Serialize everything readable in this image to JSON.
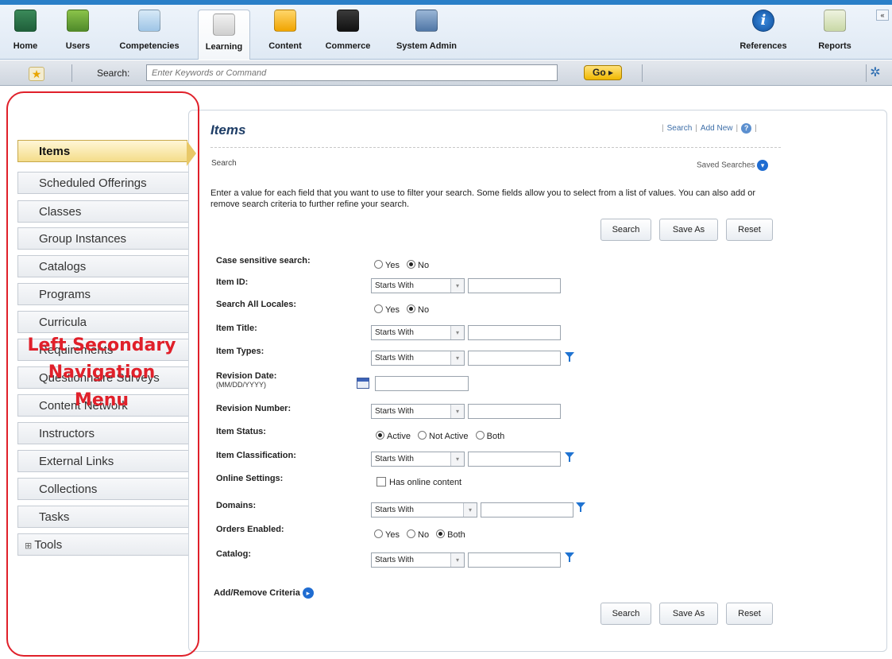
{
  "topnav": {
    "items": [
      {
        "label": "Home",
        "icon": "home-icon"
      },
      {
        "label": "Users",
        "icon": "users-icon"
      },
      {
        "label": "Competencies",
        "icon": "competencies-icon"
      },
      {
        "label": "Learning",
        "icon": "learning-icon",
        "active": true
      },
      {
        "label": "Content",
        "icon": "content-icon"
      },
      {
        "label": "Commerce",
        "icon": "commerce-icon"
      },
      {
        "label": "System Admin",
        "icon": "system-admin-icon"
      },
      {
        "label": "References",
        "icon": "info-icon"
      },
      {
        "label": "Reports",
        "icon": "reports-icon"
      }
    ],
    "collapse_glyph": "«"
  },
  "searchbar": {
    "label": "Search:",
    "placeholder": "Enter Keywords or Command",
    "go_label": "Go ▸"
  },
  "leftnav": {
    "items": [
      {
        "label": "Items",
        "active": true
      },
      {
        "label": "Scheduled Offerings"
      },
      {
        "label": "Classes"
      },
      {
        "label": "Group Instances"
      },
      {
        "label": "Catalogs"
      },
      {
        "label": "Programs"
      },
      {
        "label": "Curricula"
      },
      {
        "label": "Requirements"
      },
      {
        "label": "Questionnaire Surveys"
      },
      {
        "label": "Content Network"
      },
      {
        "label": "Instructors"
      },
      {
        "label": "External Links"
      },
      {
        "label": "Collections"
      },
      {
        "label": "Tasks"
      },
      {
        "label": "Tools",
        "expandable": true
      }
    ]
  },
  "annotation": {
    "lines": [
      "Left Secondary",
      "Navigation",
      "Menu"
    ],
    "color": "#e0202a"
  },
  "main": {
    "title": "Items",
    "header_links": {
      "search": "Search",
      "add_new": "Add New"
    },
    "section": "Search",
    "saved_searches": "Saved Searches",
    "instructions": "Enter a value for each field that you want to use to filter your search. Some fields allow you to select from a list of values. You can also add or remove search criteria to further refine your search.",
    "buttons": {
      "search": "Search",
      "save_as": "Save As",
      "reset": "Reset"
    },
    "fields": {
      "case_sensitive": {
        "label": "Case sensitive search:",
        "yes": "Yes",
        "no": "No",
        "selected": "No"
      },
      "item_id": {
        "label": "Item ID:",
        "operator": "Starts With",
        "value": ""
      },
      "all_locales": {
        "label": "Search All Locales:",
        "yes": "Yes",
        "no": "No",
        "selected": "No"
      },
      "item_title": {
        "label": "Item Title:",
        "operator": "Starts With",
        "value": ""
      },
      "item_types": {
        "label": "Item Types:",
        "operator": "Starts With",
        "value": ""
      },
      "revision_date": {
        "label": "Revision Date:",
        "format": "(MM/DD/YYYY)",
        "value": ""
      },
      "revision_number": {
        "label": "Revision Number:",
        "operator": "Starts With",
        "value": ""
      },
      "item_status": {
        "label": "Item Status:",
        "active": "Active",
        "not_active": "Not Active",
        "both": "Both",
        "selected": "Active"
      },
      "item_classification": {
        "label": "Item Classification:",
        "operator": "Starts With",
        "value": ""
      },
      "online_settings": {
        "label": "Online Settings:",
        "checkbox": "Has online content",
        "checked": false
      },
      "domains": {
        "label": "Domains:",
        "operator": "Starts With",
        "value": ""
      },
      "orders_enabled": {
        "label": "Orders Enabled:",
        "yes": "Yes",
        "no": "No",
        "both": "Both",
        "selected": "Both"
      },
      "catalog": {
        "label": "Catalog:",
        "operator": "Starts With",
        "value": ""
      }
    },
    "add_remove": "Add/Remove Criteria"
  }
}
